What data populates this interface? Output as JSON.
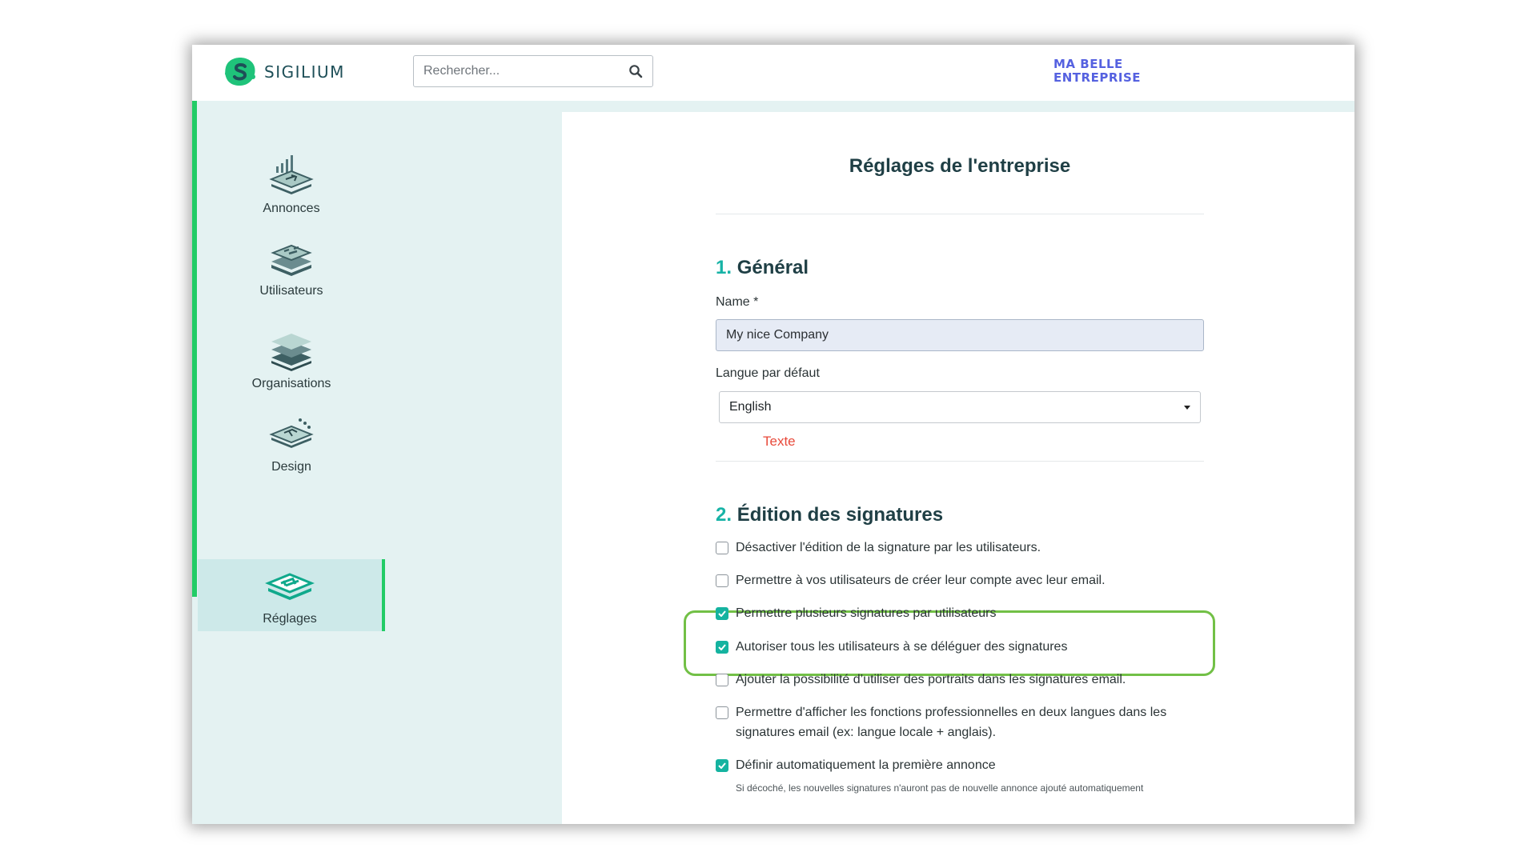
{
  "app": {
    "logo_text": "SIGILIUM",
    "brand_line1": "MA BELLE",
    "brand_line2": "ENTREPRISE",
    "search_placeholder": "Rechercher..."
  },
  "sidebar": {
    "items": [
      {
        "label": "Annonces",
        "icon": "announcements-icon"
      },
      {
        "label": "Utilisateurs",
        "icon": "users-icon"
      },
      {
        "label": "Organisations",
        "icon": "organisations-icon"
      },
      {
        "label": "Design",
        "icon": "design-icon"
      },
      {
        "label": "Réglages",
        "icon": "settings-icon",
        "active": true
      }
    ]
  },
  "page": {
    "title": "Réglages de l'entreprise",
    "section1": {
      "number": "1.",
      "title": "Général",
      "name_label": "Name *",
      "name_value": "My nice Company",
      "lang_label": "Langue par défaut",
      "lang_value": "English",
      "hint": "Texte"
    },
    "section2": {
      "number": "2.",
      "title": "Édition des signatures",
      "options": [
        {
          "label": "Désactiver l'édition de la signature par les utilisateurs.",
          "checked": false
        },
        {
          "label": "Permettre à vos utilisateurs de créer leur compte avec leur email.",
          "checked": false
        },
        {
          "label": "Permettre plusieurs signatures par utilisateurs",
          "checked": true
        },
        {
          "label": "Autoriser tous les utilisateurs à se déléguer des signatures",
          "checked": true
        },
        {
          "label": "Ajouter la possibilité d’utiliser des portraits dans les signatures email.",
          "checked": false
        },
        {
          "label": "Permettre d'afficher les fonctions professionnelles en deux langues dans les signatures email (ex: langue locale + anglais).",
          "checked": false
        },
        {
          "label": "Définir automatiquement la première annonce",
          "checked": true,
          "help": "Si décoché, les nouvelles signatures n'auront pas de nouvelle annonce ajouté automatiquement"
        }
      ]
    }
  },
  "colors": {
    "accent_green": "#22cc66",
    "teal": "#15b3a0",
    "highlight": "#72c046",
    "brand_blue": "#5561e0",
    "error_red": "#e84a3b"
  }
}
